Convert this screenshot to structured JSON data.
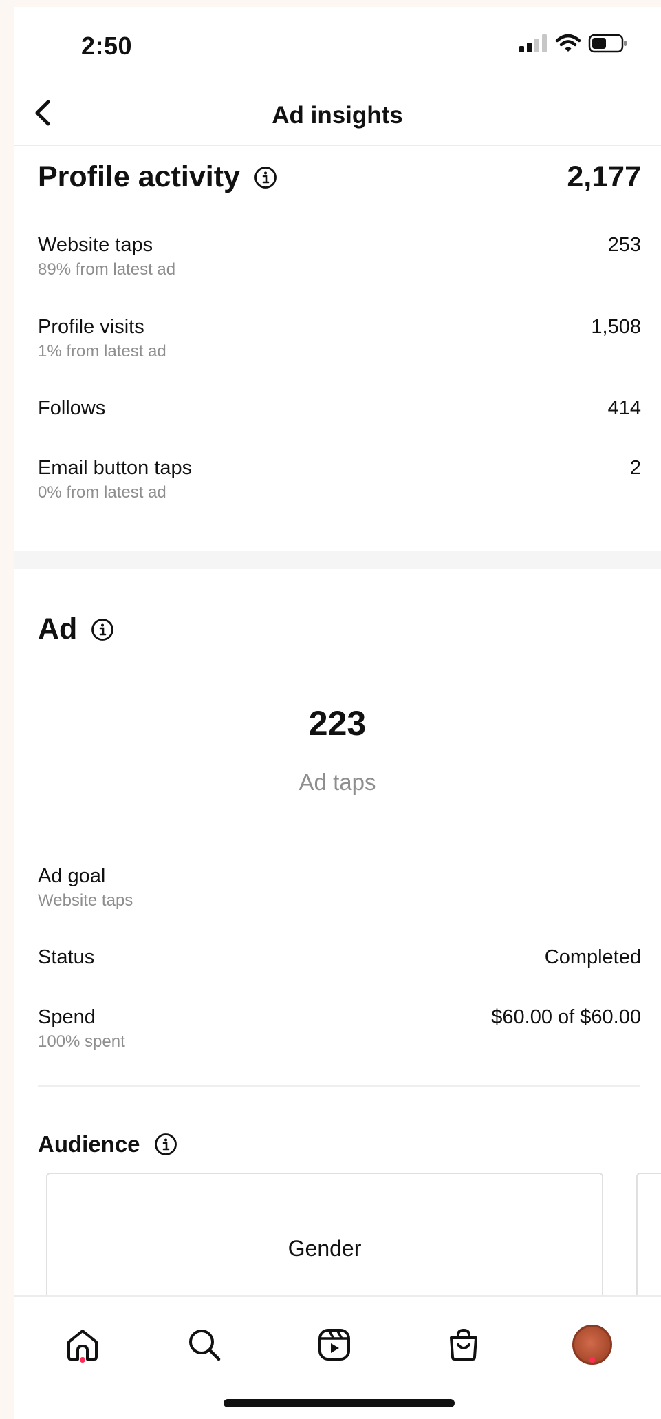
{
  "status_bar": {
    "time": "2:50"
  },
  "header": {
    "title": "Ad insights"
  },
  "profile_activity": {
    "title": "Profile activity",
    "total": "2,177",
    "rows": [
      {
        "label": "Website taps",
        "sub": "89% from latest ad",
        "value": "253"
      },
      {
        "label": "Profile visits",
        "sub": "1% from latest ad",
        "value": "1,508"
      },
      {
        "label": "Follows",
        "sub": "",
        "value": "414"
      },
      {
        "label": "Email button taps",
        "sub": "0% from latest ad",
        "value": "2"
      }
    ]
  },
  "ad": {
    "title": "Ad",
    "big_number": "223",
    "big_label": "Ad taps",
    "goal_label": "Ad goal",
    "goal_value": "Website taps",
    "status_label": "Status",
    "status_value": "Completed",
    "spend_label": "Spend",
    "spend_sub": "100% spent",
    "spend_value": "$60.00 of $60.00"
  },
  "audience": {
    "title": "Audience",
    "card_title": "Gender"
  },
  "tabbar": {
    "items": [
      {
        "icon": "home-icon",
        "notification_dot": true
      },
      {
        "icon": "search-icon",
        "notification_dot": false
      },
      {
        "icon": "reels-icon",
        "notification_dot": false
      },
      {
        "icon": "shop-icon",
        "notification_dot": false
      },
      {
        "icon": "profile-avatar",
        "notification_dot": true
      }
    ]
  },
  "colors": {
    "notification_dot": "#ff2d55",
    "secondary_text": "#8e8e8e"
  }
}
